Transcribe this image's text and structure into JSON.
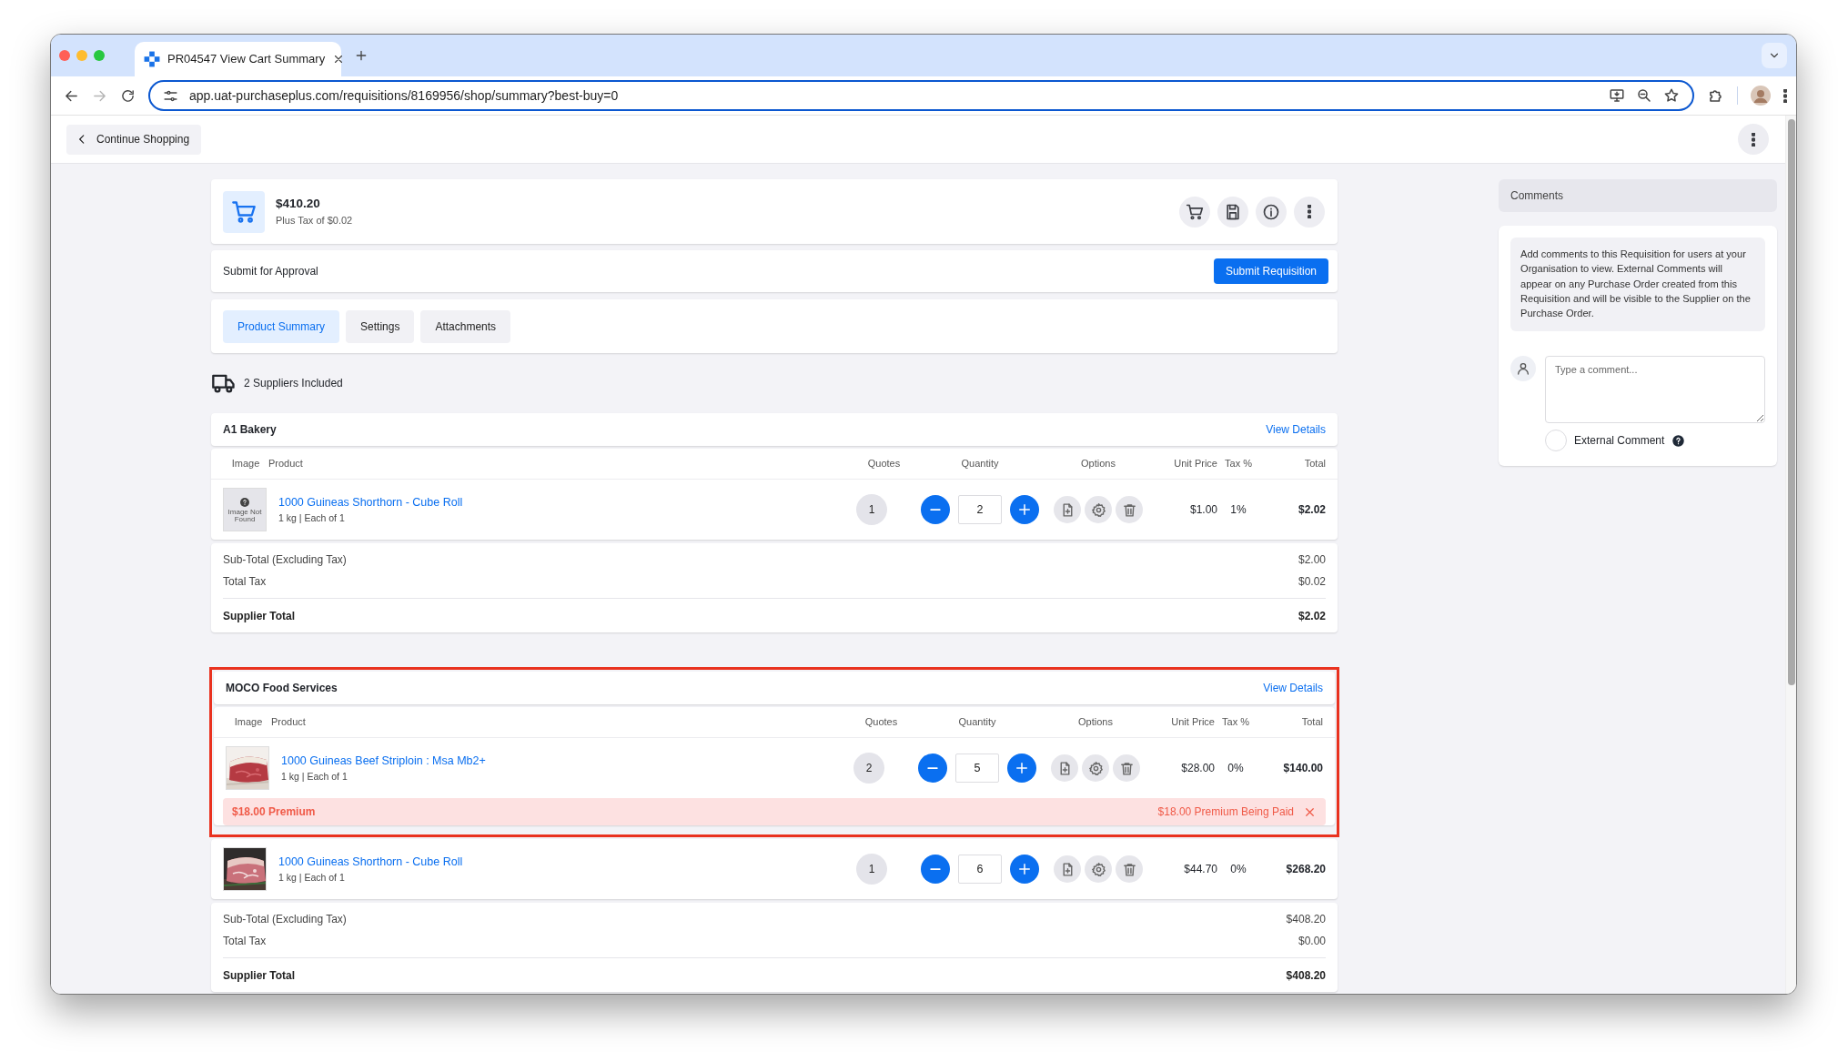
{
  "browser": {
    "tab_title": "PR04547 View Cart Summary",
    "url": "app.uat-purchaseplus.com/requisitions/8169956/shop/summary?best-buy=0",
    "forward_disabled": true
  },
  "header": {
    "back_button": "Continue Shopping"
  },
  "cart": {
    "total": "$410.20",
    "tax_note": "Plus Tax of $0.02"
  },
  "approval": {
    "label": "Submit for Approval",
    "button": "Submit Requisition"
  },
  "tabs": [
    {
      "label": "Product Summary",
      "selected": true
    },
    {
      "label": "Settings",
      "selected": false
    },
    {
      "label": "Attachments",
      "selected": false
    }
  ],
  "suppliers_included": "2 Suppliers Included",
  "suppliers": [
    {
      "name": "A1 Bakery",
      "link": "View Details",
      "columns": [
        "Image",
        "Product",
        "Quotes",
        "Quantity",
        "Options",
        "Unit Price",
        "Tax %",
        "Total"
      ],
      "items": [
        {
          "image": {
            "kind": "missing",
            "label": "Image Not Found"
          },
          "product": "1000 Guineas Shorthorn - Cube Roll",
          "unit": "1 kg | Each of 1",
          "quotes": "1",
          "quantity": "2",
          "unit_price": "$1.00",
          "tax": "1%",
          "total": "$2.02",
          "highlighted": false
        }
      ],
      "totals": [
        {
          "kind": "sub",
          "label": "Sub-Total (Excluding Tax)",
          "value": "$2.00"
        },
        {
          "kind": "tax",
          "label": "Total Tax",
          "value": "$0.02"
        },
        {
          "kind": "total",
          "label": "Supplier Total",
          "value": "$2.02"
        }
      ]
    },
    {
      "name": "MOCO Food Services",
      "link": "View Details",
      "columns": [
        "Image",
        "Product",
        "Quotes",
        "Quantity",
        "Options",
        "Unit Price",
        "Tax %",
        "Total"
      ],
      "items": [
        {
          "product": "1000 Guineas Beef Striploin : Msa Mb2+",
          "unit": "1 kg | Each of 1",
          "quotes": "2",
          "quantity": "5",
          "unit_price": "$28.00",
          "tax": "0%",
          "total": "$140.00",
          "premium": {
            "label": "$18.00 Premium",
            "status": "$18.00 Premium Being Paid"
          },
          "highlighted": true
        },
        {
          "product": "1000 Guineas Shorthorn - Cube Roll",
          "unit": "1 kg | Each of 1",
          "quotes": "1",
          "quantity": "6",
          "unit_price": "$44.70",
          "tax": "0%",
          "total": "$268.20",
          "highlighted": false
        }
      ],
      "totals": [
        {
          "kind": "sub",
          "label": "Sub-Total (Excluding Tax)",
          "value": "$408.20"
        },
        {
          "kind": "tax",
          "label": "Total Tax",
          "value": "$0.00"
        },
        {
          "kind": "total",
          "label": "Supplier Total",
          "value": "$408.20"
        }
      ]
    }
  ],
  "comments": {
    "title": "Comments",
    "info": "Add comments to this Requisition for users at your Organisation to view. External Comments will appear on any Purchase Order created from this Requisition and will be visible to the Supplier on the Purchase Order.",
    "placeholder": "Type a comment...",
    "external": {
      "label": "External Comment",
      "checked": false
    }
  }
}
